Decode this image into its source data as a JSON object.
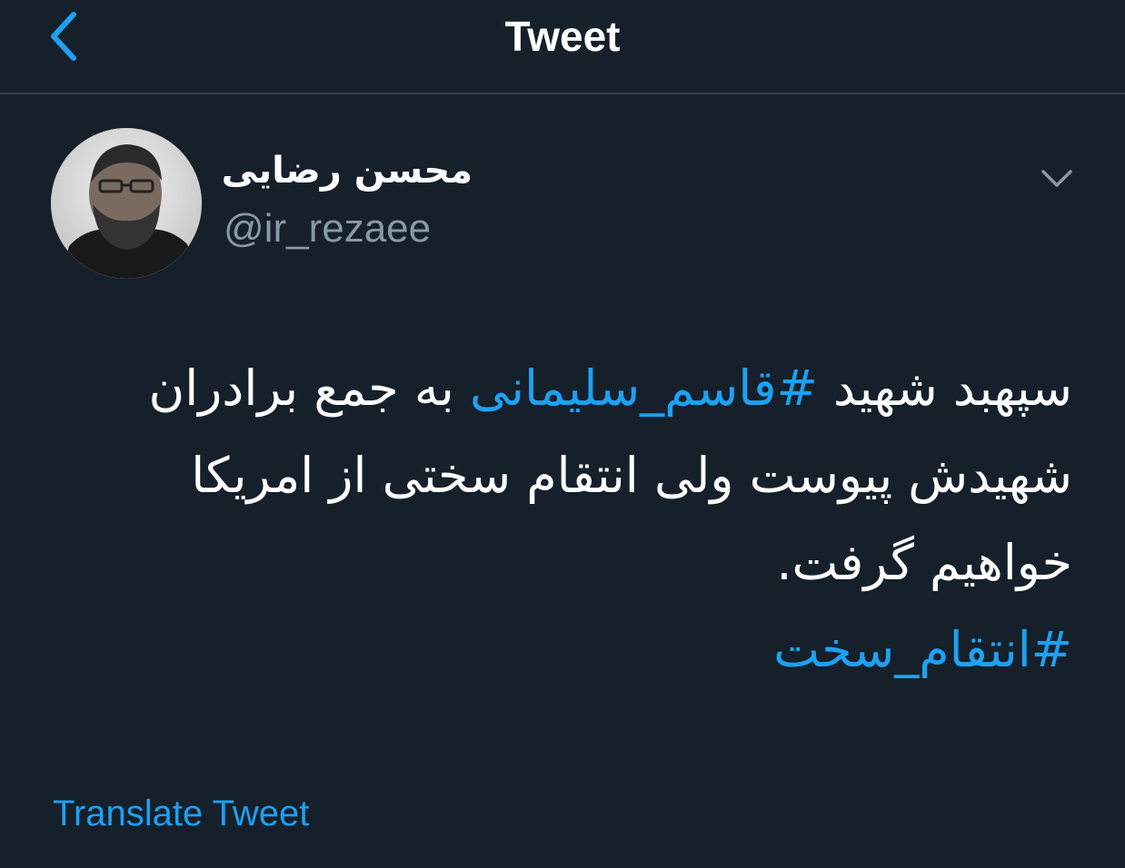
{
  "header": {
    "title": "Tweet",
    "back_icon": "chevron-left-icon",
    "accent_color": "#1da1f2"
  },
  "tweet": {
    "author": {
      "display_name": "محسن رضایی",
      "handle": "@ir_rezaee",
      "avatar_icon": "avatar-photo"
    },
    "more_icon": "chevron-down-icon",
    "lines": [
      {
        "before": "سپهبد شهید ",
        "hashtag": "#قاسم_سلیمانی",
        "after": " به جمع برادران"
      },
      {
        "before": "شهیدش پیوست ولی انتقام سختی از امریکا",
        "hashtag": "",
        "after": ""
      },
      {
        "before": "خواهیم گرفت.",
        "hashtag": "",
        "after": ""
      },
      {
        "before": "",
        "hashtag": "#انتقام_سخت",
        "after": ""
      }
    ],
    "translate_label": "Translate Tweet"
  },
  "colors": {
    "background": "#15202b",
    "divider": "#38444d",
    "secondary_text": "#8899a6",
    "link": "#1da1f2"
  }
}
